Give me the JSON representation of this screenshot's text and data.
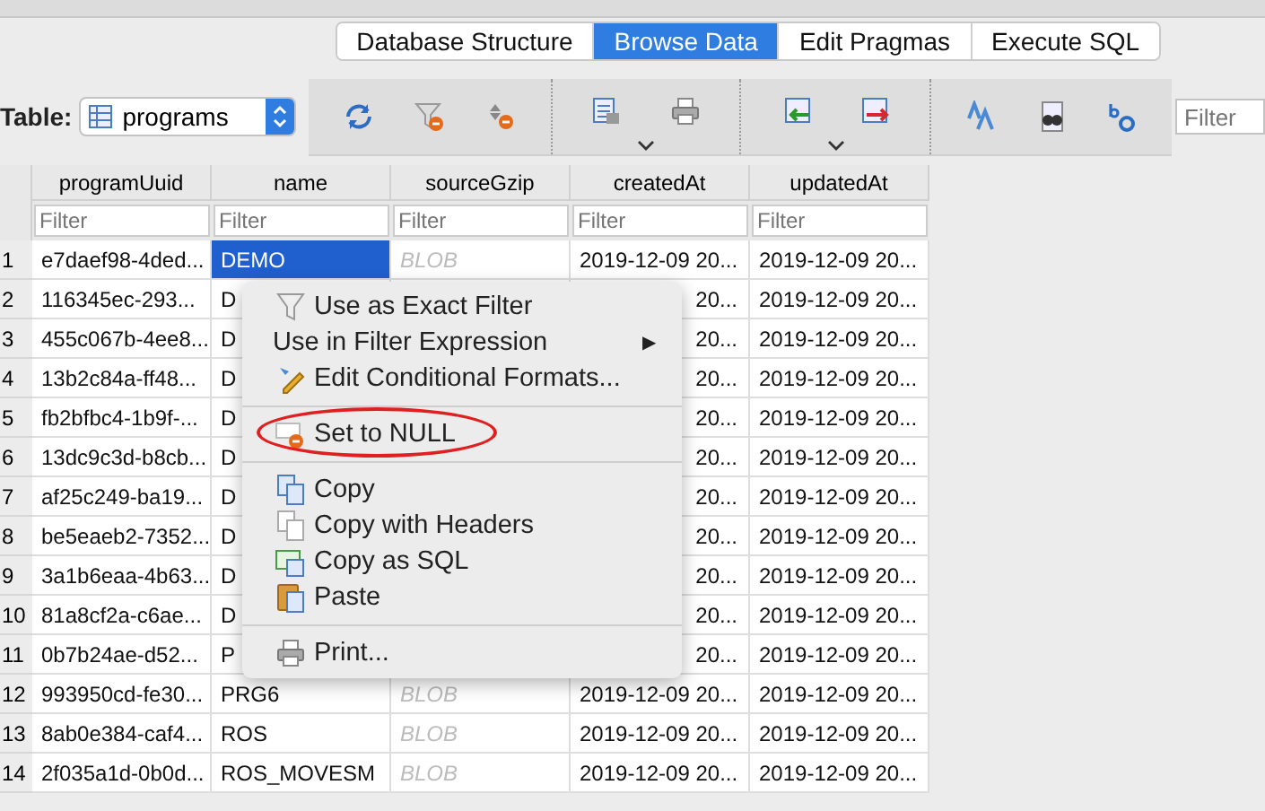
{
  "tabs": [
    {
      "label": "Database Structure",
      "selected": false
    },
    {
      "label": "Browse Data",
      "selected": true
    },
    {
      "label": "Edit Pragmas",
      "selected": false
    },
    {
      "label": "Execute SQL",
      "selected": false
    }
  ],
  "table_selector": {
    "label": "Table:",
    "value": "programs"
  },
  "toolbar": {
    "groups": [
      {
        "dropdown": false
      },
      {
        "dropdown": true
      },
      {
        "dropdown": true
      },
      {
        "dropdown": false
      }
    ],
    "filter_placeholder": "Filter"
  },
  "table": {
    "columns": [
      "programUuid",
      "name",
      "sourceGzip",
      "createdAt",
      "updatedAt"
    ],
    "filters": [
      {
        "placeholder": "Filter"
      },
      {
        "placeholder": "Filter"
      },
      {
        "placeholder": "Filter"
      },
      {
        "placeholder": "Filter"
      },
      {
        "placeholder": "Filter"
      }
    ],
    "rows": [
      {
        "num": "1",
        "covered": false,
        "name_selected": true,
        "uuid": "e7daef98-4ded...",
        "name": "DEMO",
        "source_gzip": "BLOB",
        "created_at": "2019-12-09 20...",
        "updated_at": "2019-12-09 20..."
      },
      {
        "num": "2",
        "covered": true,
        "name_selected": false,
        "uuid": "116345ec-293...",
        "name": "D",
        "created_at": "20...",
        "updated_at": "2019-12-09 20..."
      },
      {
        "num": "3",
        "covered": true,
        "name_selected": false,
        "uuid": "455c067b-4ee8...",
        "name": "D",
        "created_at": "20...",
        "updated_at": "2019-12-09 20..."
      },
      {
        "num": "4",
        "covered": true,
        "name_selected": false,
        "uuid": "13b2c84a-ff48...",
        "name": "D",
        "created_at": "20...",
        "updated_at": "2019-12-09 20..."
      },
      {
        "num": "5",
        "covered": true,
        "name_selected": false,
        "uuid": "fb2bfbc4-1b9f-...",
        "name": "D",
        "created_at": "20...",
        "updated_at": "2019-12-09 20..."
      },
      {
        "num": "6",
        "covered": true,
        "name_selected": false,
        "uuid": "13dc9c3d-b8cb...",
        "name": "D",
        "created_at": "20...",
        "updated_at": "2019-12-09 20..."
      },
      {
        "num": "7",
        "covered": true,
        "name_selected": false,
        "uuid": "af25c249-ba19...",
        "name": "D",
        "created_at": "20...",
        "updated_at": "2019-12-09 20..."
      },
      {
        "num": "8",
        "covered": true,
        "name_selected": false,
        "uuid": "be5eaeb2-7352...",
        "name": "D",
        "created_at": "20...",
        "updated_at": "2019-12-09 20..."
      },
      {
        "num": "9",
        "covered": true,
        "name_selected": false,
        "uuid": "3a1b6eaa-4b63...",
        "name": "D",
        "created_at": "20...",
        "updated_at": "2019-12-09 20..."
      },
      {
        "num": "10",
        "covered": true,
        "name_selected": false,
        "uuid": "81a8cf2a-c6ae...",
        "name": "D",
        "created_at": "20...",
        "updated_at": "2019-12-09 20..."
      },
      {
        "num": "11",
        "covered": true,
        "name_selected": false,
        "uuid": "0b7b24ae-d52...",
        "name": "P",
        "created_at": "20...",
        "updated_at": "2019-12-09 20..."
      },
      {
        "num": "12",
        "covered": false,
        "name_selected": false,
        "uuid": "993950cd-fe30...",
        "name": "PRG6",
        "source_gzip": "BLOB",
        "created_at": "2019-12-09 20...",
        "updated_at": "2019-12-09 20..."
      },
      {
        "num": "13",
        "covered": false,
        "name_selected": false,
        "uuid": "8ab0e384-caf4...",
        "name": "ROS",
        "source_gzip": "BLOB",
        "created_at": "2019-12-09 20...",
        "updated_at": "2019-12-09 20..."
      },
      {
        "num": "14",
        "covered": false,
        "name_selected": false,
        "uuid": "2f035a1d-0b0d...",
        "name": "ROS_MOVESM",
        "source_gzip": "BLOB",
        "created_at": "2019-12-09 20...",
        "updated_at": "2019-12-09 20..."
      }
    ]
  },
  "context_menu": {
    "items": [
      {
        "kind": "item",
        "label": "Use as Exact Filter",
        "circled": false
      },
      {
        "kind": "submenu",
        "label": "Use in Filter Expression",
        "arrow": "▶"
      },
      {
        "kind": "item",
        "label": "Edit Conditional Formats...",
        "circled": false
      },
      {
        "kind": "separator"
      },
      {
        "kind": "item",
        "label": "Set to NULL",
        "circled": true
      },
      {
        "kind": "separator"
      },
      {
        "kind": "item",
        "label": "Copy",
        "circled": false
      },
      {
        "kind": "item",
        "label": "Copy with Headers",
        "circled": false
      },
      {
        "kind": "item",
        "label": "Copy as SQL",
        "circled": false
      },
      {
        "kind": "item",
        "label": "Paste",
        "circled": false
      },
      {
        "kind": "separator"
      },
      {
        "kind": "item",
        "label": "Print...",
        "circled": false
      }
    ]
  }
}
